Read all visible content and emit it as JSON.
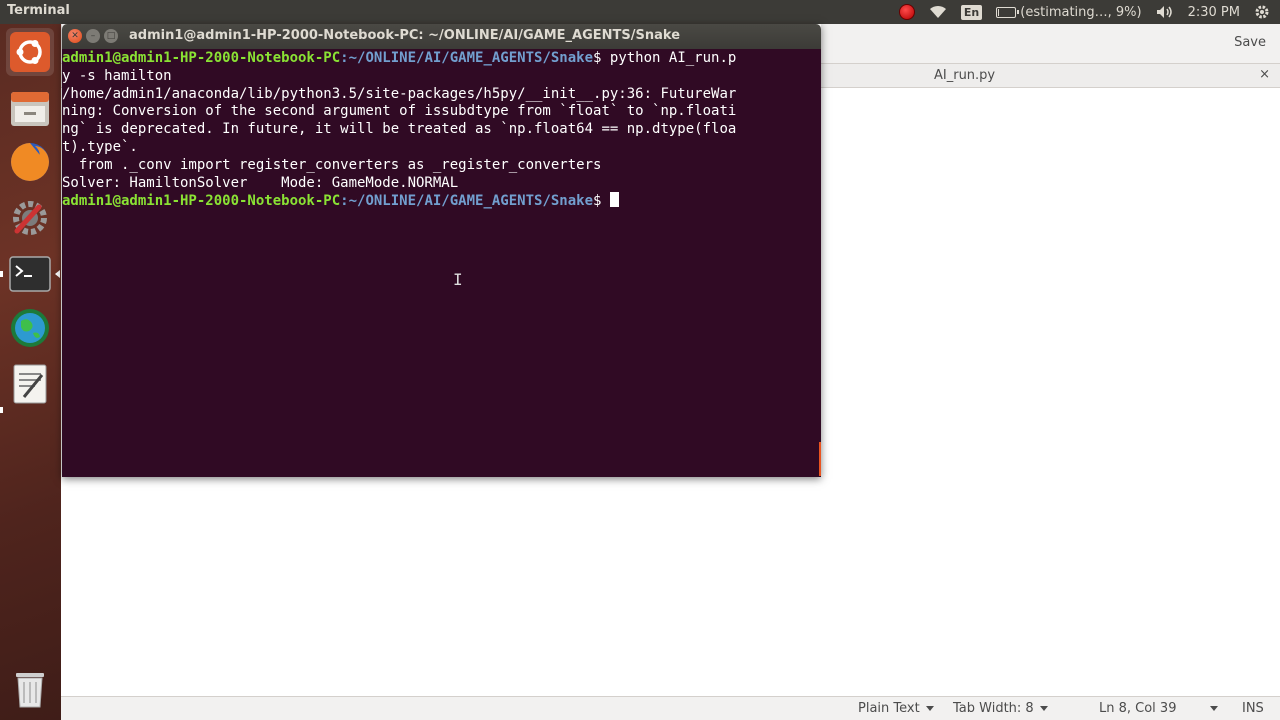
{
  "top_panel": {
    "app_name": "Terminal",
    "icons": [
      "record-icon",
      "wifi-icon",
      "keyboard-layout-icon",
      "battery-icon",
      "volume-icon",
      "power-gear-icon"
    ],
    "keyboard_layout": "En",
    "battery_text": "(estimating…, 9%)",
    "battery_level_percent": 9,
    "clock": "2:30 PM"
  },
  "launcher": {
    "items": [
      {
        "name": "ubuntu-dash",
        "icon": "ubuntu-logo-icon"
      },
      {
        "name": "files",
        "icon": "file-cabinet-icon"
      },
      {
        "name": "firefox",
        "icon": "firefox-icon"
      },
      {
        "name": "system-settings",
        "icon": "settings-wrench-icon"
      },
      {
        "name": "terminal",
        "icon": "terminal-icon"
      },
      {
        "name": "globe-app",
        "icon": "globe-icon"
      },
      {
        "name": "text-editor",
        "icon": "text-editor-icon"
      },
      {
        "name": "trash",
        "icon": "trash-icon"
      }
    ]
  },
  "terminal": {
    "title": "admin1@admin1-HP-2000-Notebook-PC: ~/ONLINE/AI/GAME_AGENTS/Snake",
    "prompt_user": "admin1@admin1-HP-2000-Notebook-PC",
    "prompt_path": ":~/ONLINE/AI/GAME_AGENTS/Snake",
    "prompt_symbol": "$",
    "command_part1": " python AI_run.p",
    "command_part2": "y -s hamilton",
    "output_lines": [
      "/home/admin1/anaconda/lib/python3.5/site-packages/h5py/__init__.py:36: FutureWar",
      "ning: Conversion of the second argument of issubdtype from `float` to `np.floati",
      "ng` is deprecated. In future, it will be treated as `np.float64 == np.dtype(floa",
      "t).type`.",
      "  from ._conv import register_converters as _register_converters",
      "Solver: HamiltonSolver    Mode: GameMode.NORMAL"
    ]
  },
  "gedit": {
    "save_label": "Save",
    "tab_title": "AI_run.py",
    "tab_close": "×",
    "status": {
      "language": "Plain Text",
      "tab_width": "Tab Width: 8",
      "position": "Ln 8, Col 39",
      "mode": "INS"
    }
  },
  "colors": {
    "terminal_bg": "#300a24",
    "prompt_user": "#8ae234",
    "prompt_path": "#729fcf",
    "panel_bg": "#3c3b37",
    "accent_orange": "#e95420"
  }
}
